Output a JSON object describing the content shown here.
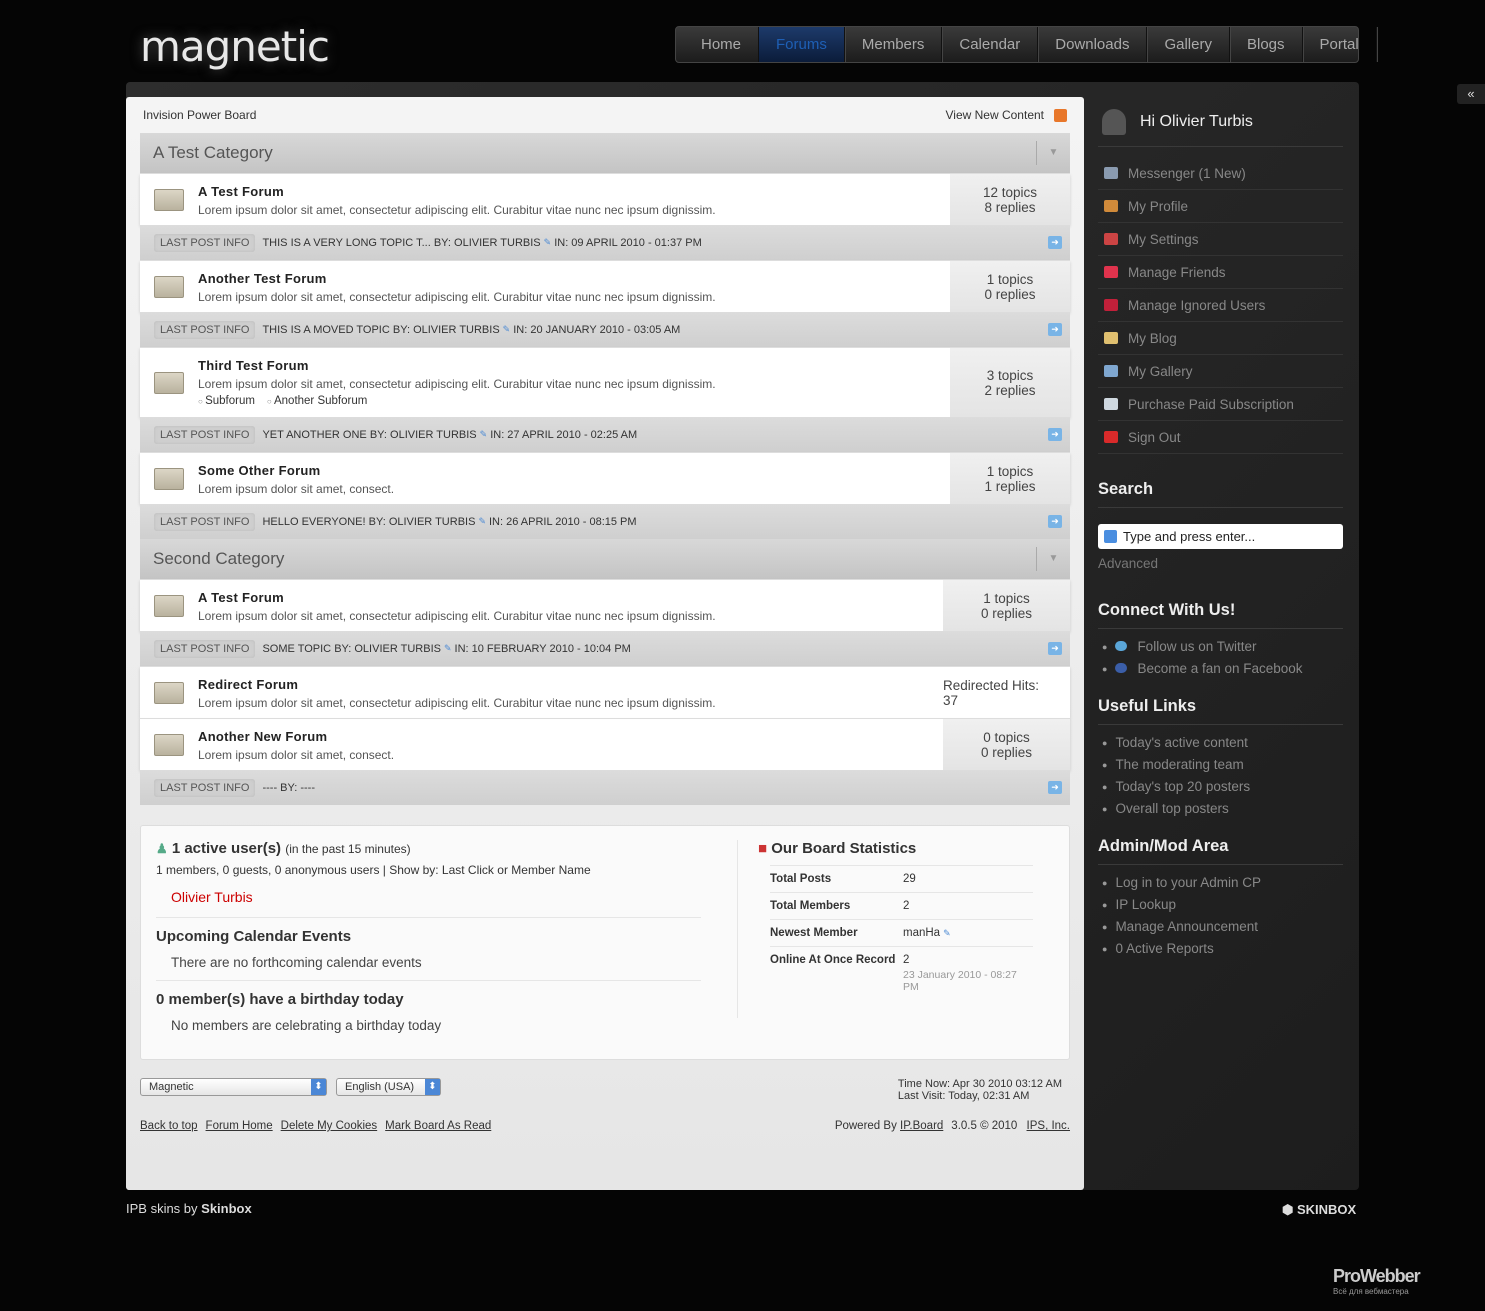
{
  "logo": "magnetic",
  "nav": [
    "Home",
    "Forums",
    "Members",
    "Calendar",
    "Downloads",
    "Gallery",
    "Blogs",
    "Portal"
  ],
  "nav_active": "Forums",
  "collapse_icon": "«",
  "breadcrumb": "Invision Power Board",
  "view_new": "View New Content",
  "last_post_label": "LAST POST INFO",
  "categories": [
    {
      "name": "A Test Category",
      "forums": [
        {
          "name": "A Test Forum",
          "desc": "Lorem ipsum dolor sit amet, consectetur adipiscing elit. Curabitur vitae nunc nec ipsum dignissim.",
          "topics": "12 topics",
          "replies": "8 replies",
          "last_topic": "THIS IS A VERY LONG TOPIC T...",
          "by": "BY:",
          "author": "OLIVIER TURBIS",
          "date": "IN: 09 APRIL 2010 - 01:37 PM"
        },
        {
          "name": "Another Test Forum",
          "desc": "Lorem ipsum dolor sit amet, consectetur adipiscing elit. Curabitur vitae nunc nec ipsum dignissim.",
          "topics": "1 topics",
          "replies": "0 replies",
          "last_topic": "THIS IS A MOVED TOPIC",
          "by": "BY:",
          "author": "OLIVIER TURBIS",
          "date": "IN: 20 JANUARY 2010 - 03:05 AM"
        },
        {
          "name": "Third Test Forum",
          "desc": "Lorem ipsum dolor sit amet, consectetur adipiscing elit. Curabitur vitae nunc nec ipsum dignissim.",
          "subforums": [
            "Subforum",
            "Another Subforum"
          ],
          "topics": "3 topics",
          "replies": "2 replies",
          "last_topic": "YET ANOTHER ONE",
          "by": "BY:",
          "author": "OLIVIER TURBIS",
          "date": "IN: 27 APRIL 2010 - 02:25 AM"
        },
        {
          "name": "Some Other Forum",
          "desc": "Lorem ipsum dolor sit amet, consect.",
          "topics": "1 topics",
          "replies": "1 replies",
          "last_topic": "HELLO EVERYONE!",
          "by": "BY:",
          "author": "OLIVIER TURBIS",
          "date": "IN: 26 APRIL 2010 - 08:15 PM"
        }
      ]
    },
    {
      "name": "Second Category",
      "forums": [
        {
          "name": "A Test Forum",
          "desc": "Lorem ipsum dolor sit amet, consectetur adipiscing elit. Curabitur vitae nunc nec ipsum dignissim.",
          "topics": "1 topics",
          "replies": "0 replies",
          "last_topic": "SOME TOPIC",
          "by": "BY:",
          "author": "OLIVIER TURBIS",
          "date": "IN: 10 FEBRUARY 2010 - 10:04 PM"
        },
        {
          "name": "Redirect Forum",
          "desc": "Lorem ipsum dolor sit amet, consectetur adipiscing elit. Curabitur vitae nunc nec ipsum dignissim.",
          "redirect_label": "Redirected Hits:",
          "redirect_hits": "37"
        },
        {
          "name": "Another New Forum",
          "desc": "Lorem ipsum dolor sit amet, consect.",
          "topics": "0 topics",
          "replies": "0 replies",
          "last_topic": "----",
          "by": "BY: ----"
        }
      ]
    }
  ],
  "active": {
    "count": "1 active user(s)",
    "period": "(in the past 15 minutes)",
    "summary": "1 members, 0 guests, 0 anonymous users | Show by: Last Click or Member Name",
    "user": "Olivier Turbis"
  },
  "calendar": {
    "title": "Upcoming Calendar Events",
    "text": "There are no forthcoming calendar events"
  },
  "birthday": {
    "title": "0 member(s) have a birthday today",
    "text": "No members are celebrating a birthday today"
  },
  "board_stats": {
    "title": "Our Board Statistics",
    "rows": [
      [
        "Total Posts",
        "29"
      ],
      [
        "Total Members",
        "2"
      ],
      [
        "Newest Member",
        "manHa"
      ],
      [
        "Online At Once Record",
        "2"
      ]
    ],
    "record_date": "23 January 2010 - 08:27 PM"
  },
  "footer": {
    "skin": "Magnetic",
    "lang": "English (USA)",
    "time_now": "Time Now: Apr 30 2010 03:12 AM",
    "last_visit": "Last Visit: Today, 02:31 AM",
    "links": [
      "Back to top",
      "Forum Home",
      "Delete My Cookies",
      "Mark Board As Read"
    ],
    "powered": "Powered By",
    "ipboard": "IP.Board",
    "version": "3.0.5 © 2010",
    "ips": "IPS, Inc."
  },
  "sidebar": {
    "greeting": "Hi Olivier Turbis",
    "menu": [
      {
        "label": "Messenger (1 New)",
        "color": "#8a9bb0"
      },
      {
        "label": "My Profile",
        "color": "#d08a3a"
      },
      {
        "label": "My Settings",
        "color": "#c44"
      },
      {
        "label": "Manage Friends",
        "color": "#e0334d"
      },
      {
        "label": "Manage Ignored Users",
        "color": "#c2203a"
      },
      {
        "label": "My Blog",
        "color": "#e0c070"
      },
      {
        "label": "My Gallery",
        "color": "#7fa7d0"
      },
      {
        "label": "Purchase Paid Subscription",
        "color": "#cfd8e0"
      },
      {
        "label": "Sign Out",
        "color": "#d92a2a"
      }
    ],
    "search_title": "Search",
    "search_placeholder": "Type and press enter...",
    "advanced": "Advanced",
    "connect_title": "Connect With Us!",
    "connect": [
      "Follow us on Twitter",
      "Become a fan on Facebook"
    ],
    "links_title": "Useful Links",
    "links": [
      "Today's active content",
      "The moderating team",
      "Today's top 20 posters",
      "Overall top posters"
    ],
    "admin_title": "Admin/Mod Area",
    "admin": [
      "Log in to your Admin CP",
      "IP Lookup",
      "Manage Announcement",
      "0 Active Reports"
    ]
  },
  "credit": {
    "text": "IPB skins by",
    "brand": "Skinbox"
  },
  "skinbox": "SKINBOX",
  "prowebber": "ProWebber",
  "prowebber_sub": "Всё для вебмастера"
}
